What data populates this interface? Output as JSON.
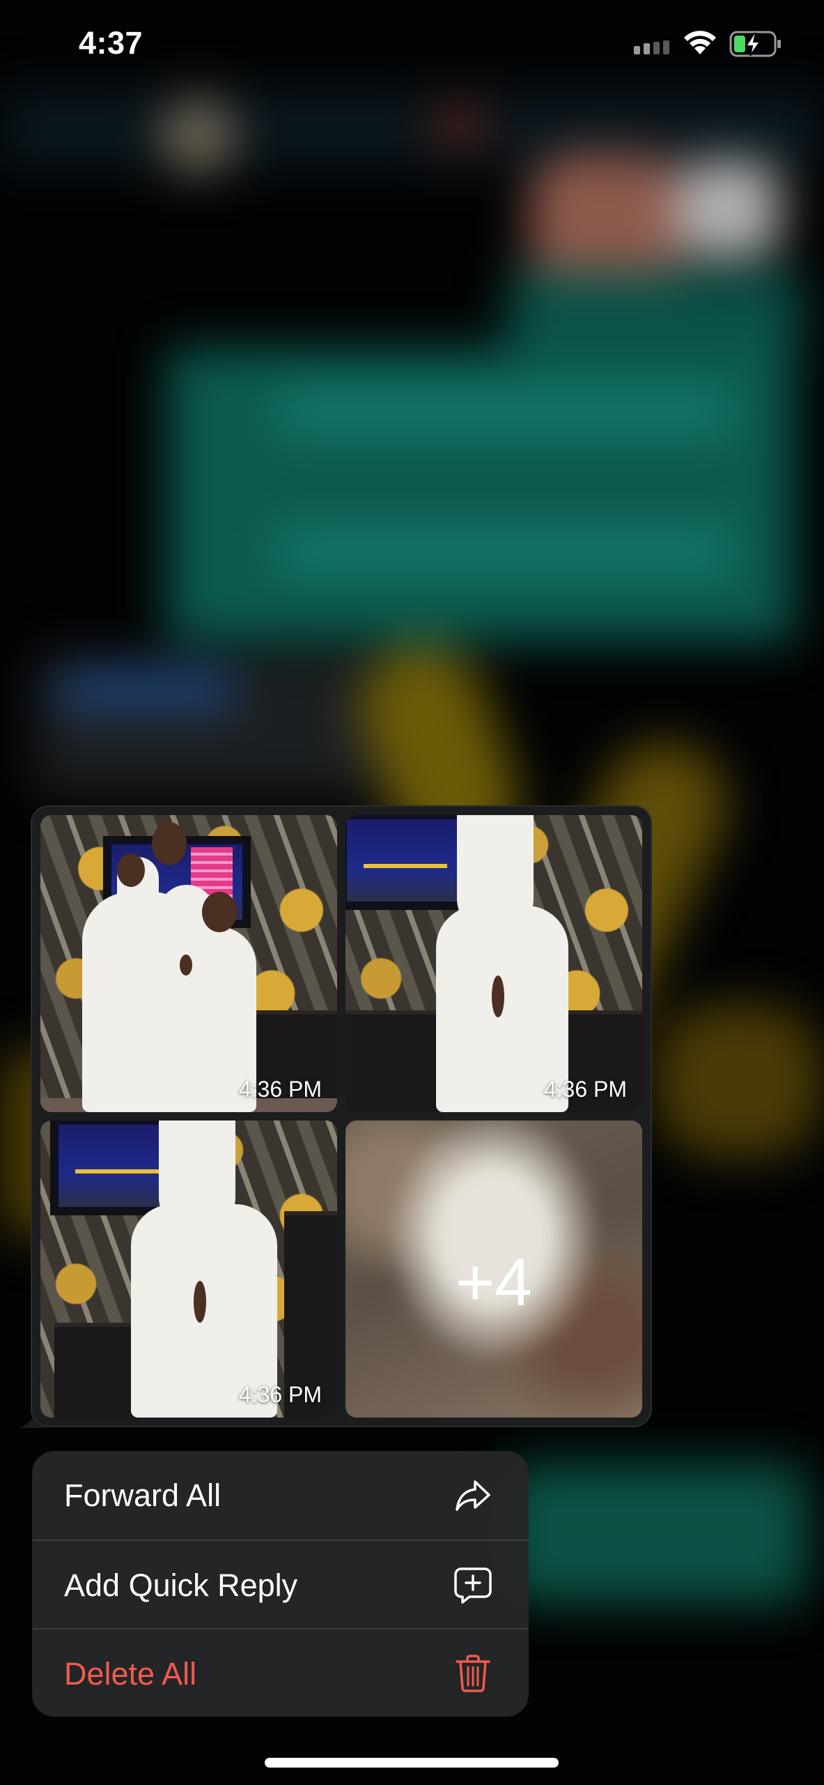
{
  "status_bar": {
    "time": "4:37",
    "cellular_icon": "cellular-signal-icon",
    "wifi_icon": "wifi-icon",
    "battery_icon": "battery-charging-icon"
  },
  "media_group": {
    "tiles": [
      {
        "timestamp": "4:36 PM"
      },
      {
        "timestamp": "4:36 PM"
      },
      {
        "timestamp": "4:36 PM"
      },
      {
        "more_count": "+4"
      }
    ]
  },
  "context_menu": {
    "items": [
      {
        "label": "Forward All",
        "icon": "forward-icon"
      },
      {
        "label": "Add Quick Reply",
        "icon": "quick-reply-icon"
      },
      {
        "label": "Delete All",
        "icon": "trash-icon",
        "color": "#ef5b4f"
      }
    ]
  }
}
